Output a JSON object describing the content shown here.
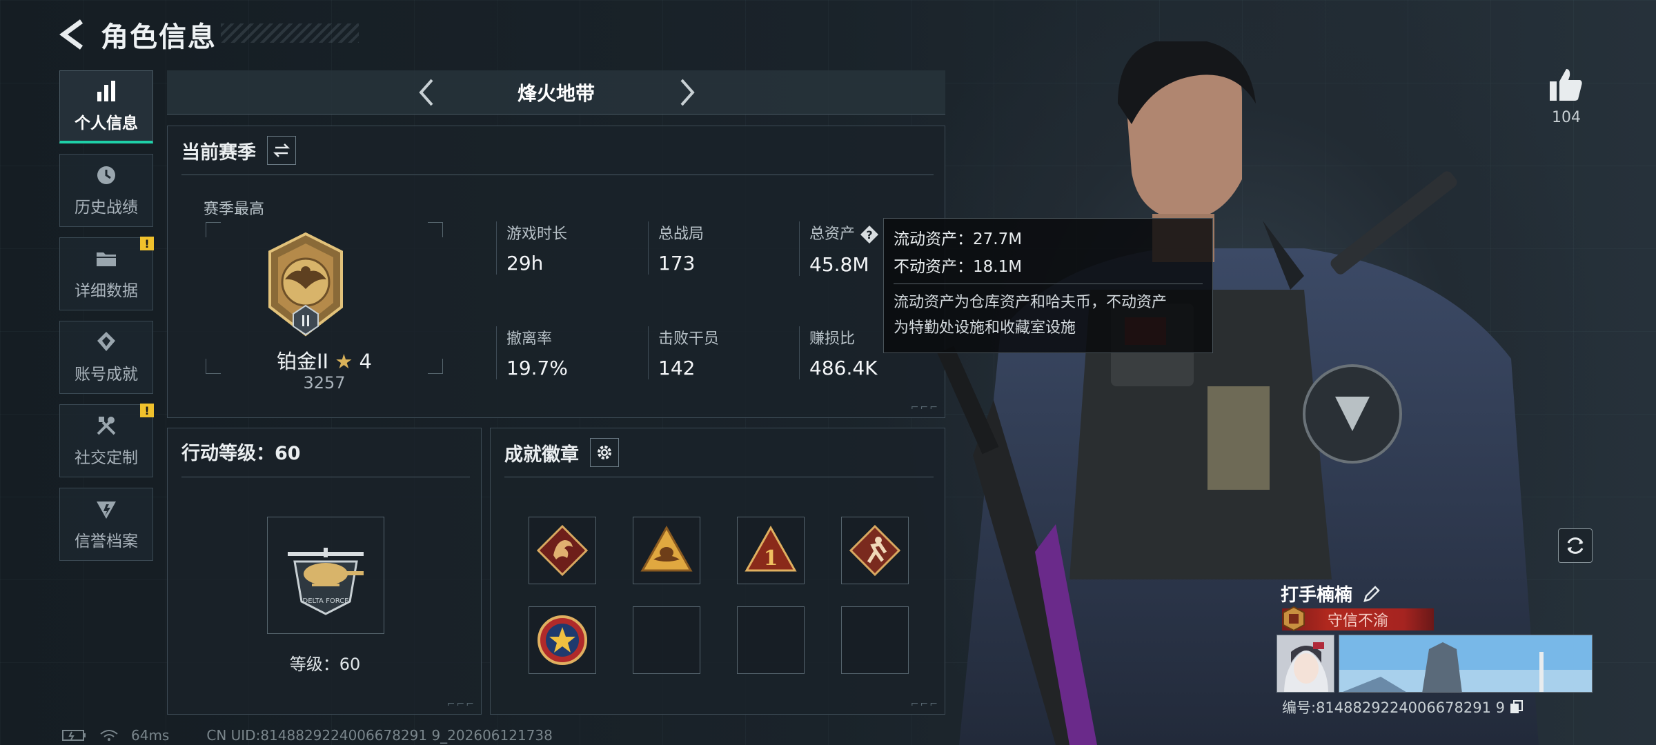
{
  "header": {
    "title": "角色信息"
  },
  "sidebar": {
    "items": [
      {
        "label": "个人信息",
        "active": true,
        "badge": ""
      },
      {
        "label": "历史战绩",
        "active": false,
        "badge": ""
      },
      {
        "label": "详细数据",
        "active": false,
        "badge": "!"
      },
      {
        "label": "账号成就",
        "active": false,
        "badge": ""
      },
      {
        "label": "社交定制",
        "active": false,
        "badge": "!"
      },
      {
        "label": "信誉档案",
        "active": false,
        "badge": ""
      }
    ]
  },
  "mode": {
    "name": "烽火地带"
  },
  "season": {
    "title": "当前赛季",
    "best_label": "赛季最高",
    "rank_name": "铂金II",
    "rank_stars": "4",
    "rank_score": "3257",
    "stats": [
      {
        "label": "游戏时长",
        "value": "29h"
      },
      {
        "label": "总战局",
        "value": "173"
      },
      {
        "label": "总资产",
        "value": "45.8M"
      },
      {
        "label": "撤离率",
        "value": "19.7%"
      },
      {
        "label": "击败干员",
        "value": "142"
      },
      {
        "label": "赚损比",
        "value": "486.4K"
      }
    ]
  },
  "tooltip": {
    "liquid": "流动资产：27.7M",
    "fixed": "不动资产：18.1M",
    "desc_1": "流动资产为仓库资产和哈夫币，不动资产",
    "desc_2": "为特勤处设施和收藏室设施"
  },
  "level": {
    "title": "行动等级：60",
    "text": "等级：60",
    "badge_text": "DELTA FORCE"
  },
  "achievements": {
    "title": "成就徽章",
    "badge_digit": "1",
    "slots": [
      "dragon-badge",
      "hat-badge",
      "number-one-badge",
      "runner-badge",
      "star-badge",
      "empty",
      "empty",
      "empty"
    ]
  },
  "profile": {
    "likes": "104",
    "player_name": "打手楠楠",
    "player_title": "守信不渝",
    "id_line": "编号:8148829224006678291 9"
  },
  "status": {
    "ping": "64ms",
    "uid": "CN UID:8148829224006678291 9_202606121738"
  },
  "colors": {
    "accent": "#1fd0a8",
    "badge_yellow": "#f0c12c",
    "title_red": "#b0281e",
    "gold": "#d9b25a"
  }
}
